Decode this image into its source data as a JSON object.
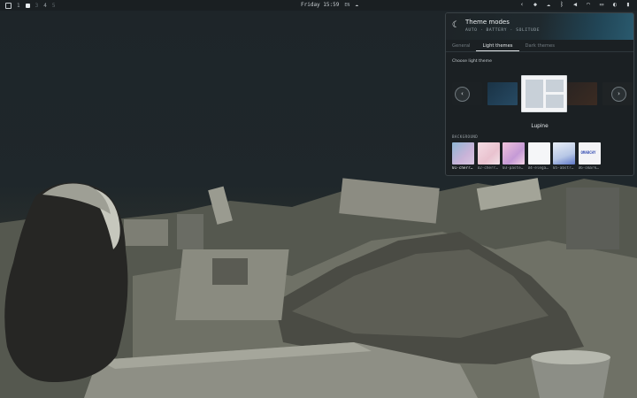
{
  "topbar": {
    "workspaces": [
      "1",
      "2",
      "3",
      "4",
      "5"
    ],
    "active_workspace": "2",
    "clock": "Friday 15:59",
    "language": "EN",
    "tray_icons": [
      "chevron-left-icon",
      "dropbox-icon",
      "cloud-icon",
      "bluetooth-icon",
      "volume-icon",
      "wifi-icon",
      "monitor-icon",
      "theme-icon",
      "battery-icon"
    ]
  },
  "panel": {
    "title": "Theme modes",
    "subtitle": "AUTO · BATTERY · SOLITUDE",
    "tabs": [
      {
        "label": "General",
        "active": false
      },
      {
        "label": "Light themes",
        "active": true
      },
      {
        "label": "Dark themes",
        "active": false
      }
    ],
    "choose_label": "Choose light theme",
    "selected_theme": "Lupine",
    "background_label": "BACKGROUND",
    "backgrounds": [
      {
        "name": "01-cherr…",
        "active": true
      },
      {
        "name": "02-cherr…",
        "active": false
      },
      {
        "name": "03-paste…",
        "active": false
      },
      {
        "name": "04-elega…",
        "active": false
      },
      {
        "name": "05-abstr…",
        "active": false
      },
      {
        "name": "06-omark…",
        "active": false
      }
    ],
    "background_logo_text": "OMARCHY"
  }
}
